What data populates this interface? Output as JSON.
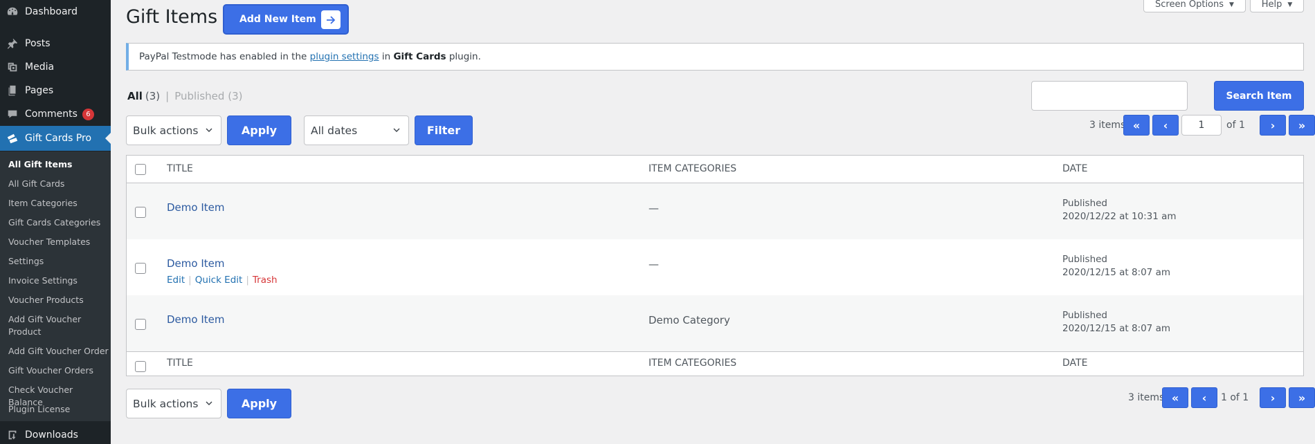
{
  "sidebar": {
    "items": [
      {
        "label": "Dashboard",
        "icon": "dashboard-icon"
      },
      {
        "label": "Posts",
        "icon": "pin-icon"
      },
      {
        "label": "Media",
        "icon": "media-icon"
      },
      {
        "label": "Pages",
        "icon": "pages-icon"
      },
      {
        "label": "Comments",
        "icon": "comment-icon",
        "badge": "6"
      },
      {
        "label": "Gift Cards Pro",
        "icon": "gift-cards-icon"
      },
      {
        "label": "Downloads",
        "icon": "download-icon"
      }
    ],
    "submenu": [
      "All Gift Items",
      "All Gift Cards",
      "Item Categories",
      "Gift Cards Categories",
      "Voucher Templates",
      "Settings",
      "Invoice Settings",
      "Voucher Products",
      "Add Gift Voucher Product",
      "Add Gift Voucher Order",
      "Gift Voucher Orders",
      "Check Voucher Balance",
      "Plugin License"
    ]
  },
  "header": {
    "title": "Gift Items",
    "add_new_label": "Add New Item",
    "screen_options_label": "Screen Options",
    "help_label": "Help"
  },
  "notice": {
    "prefix": "PayPal Testmode has enabled in the",
    "link": "plugin settings",
    "middle": "in",
    "bold": "Gift Cards",
    "suffix": "plugin."
  },
  "views": {
    "all_label": "All",
    "all_count": "(3)",
    "separator": "|",
    "published_label": "Published",
    "published_count": "(3)"
  },
  "search": {
    "value": "",
    "button_label": "Search Item"
  },
  "top_nav": {
    "bulk_actions": "Bulk actions",
    "apply_label": "Apply",
    "date_filter": "All dates",
    "filter_label": "Filter",
    "items_count": "3 items",
    "first": "«",
    "prev": "‹",
    "current_page": "1",
    "of_label": "of 1",
    "next": "›",
    "last": "»"
  },
  "bottom_nav": {
    "bulk_actions": "Bulk actions",
    "apply_label": "Apply",
    "items_count": "3 items",
    "first": "«",
    "prev": "‹",
    "page_label": "1 of 1",
    "next": "›",
    "last": "»"
  },
  "table": {
    "columns": [
      "TITLE",
      "ITEM CATEGORIES",
      "DATE"
    ],
    "rows": [
      {
        "title": "Demo Item",
        "category": "—",
        "status": "Published",
        "date": "2020/12/22 at 10:31 am"
      },
      {
        "title": "Demo Item",
        "category": "—",
        "status": "Published",
        "date": "2020/12/15 at 8:07 am"
      },
      {
        "title": "Demo Item",
        "category": "Demo Category",
        "status": "Published",
        "date": "2020/12/15 at 8:07 am"
      }
    ],
    "row_actions": {
      "edit": "Edit",
      "quick_edit": "Quick Edit",
      "trash": "Trash",
      "separator": "|"
    }
  },
  "colors": {
    "accent": "#3c6fe6",
    "sidebar": "#1d2327",
    "active_menu": "#2271b1",
    "badge": "#d63638",
    "trash": "#d63638"
  }
}
